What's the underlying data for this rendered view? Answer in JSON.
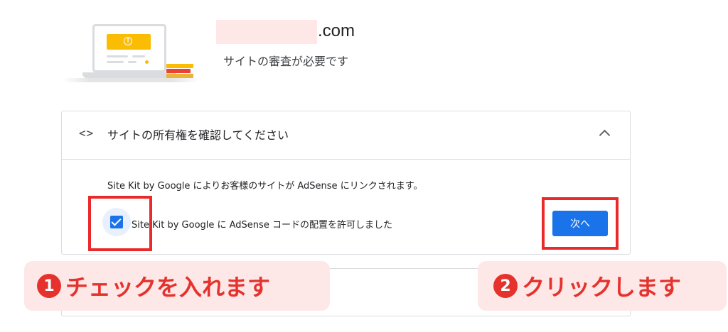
{
  "header": {
    "domain_suffix": ".com",
    "subtitle": "サイトの審査が必要です"
  },
  "card": {
    "code_icon": "<>",
    "title": "サイトの所有権を確認してください",
    "description": "Site Kit by Google によりお客様のサイトが AdSense にリンクされます。",
    "checkbox_label": "Site Kit by Google に AdSense コードの配置を許可しました",
    "checkbox_checked": true,
    "next_button_label": "次へ"
  },
  "annotations": {
    "step1_number": "1",
    "step1_label": "チェックを入れます",
    "step2_number": "2",
    "step2_label": "クリックします"
  },
  "colors": {
    "accent": "#1a73e8",
    "annotation_red": "#e5322d",
    "annotation_bg": "#fde7e7",
    "warning_yellow": "#fbbc04"
  },
  "icons": {
    "illustration": "laptop-warning-illustration",
    "warning": "exclamation-circle-icon",
    "code": "code-brackets-icon",
    "collapse": "chevron-up-icon",
    "checkbox": "checkmark-icon"
  }
}
